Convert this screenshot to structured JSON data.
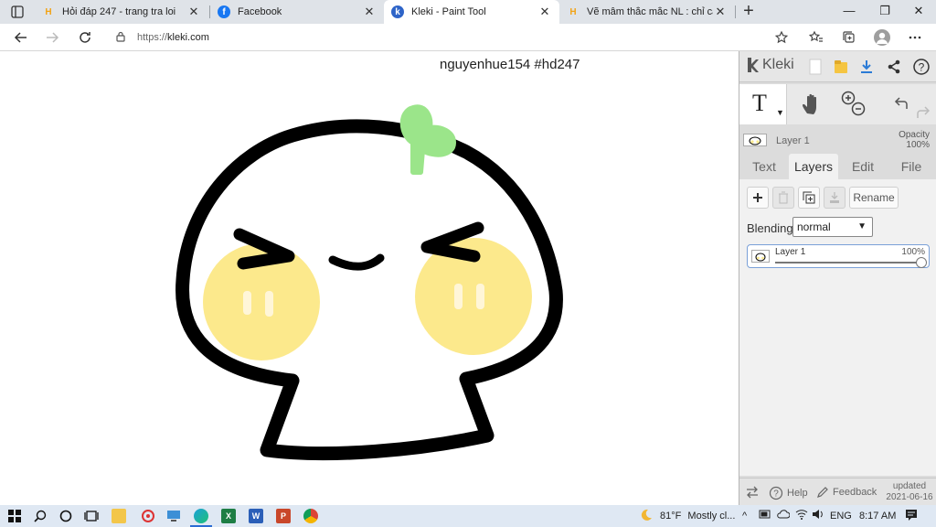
{
  "browser": {
    "tabs": [
      {
        "title": "Hỏi đáp 247 - trang tra loi",
        "favicon": "hoidap247-icon",
        "close": "✕",
        "active": false
      },
      {
        "title": "Facebook",
        "favicon": "facebook-icon",
        "close": "✕",
        "active": false
      },
      {
        "title": "Kleki - Paint Tool",
        "favicon": "kleki-icon",
        "close": "✕",
        "active": true
      },
      {
        "title": "Vẽ mâm thắc mắc NL : chỉ cách t",
        "favicon": "hoidap247-icon",
        "close": "✕",
        "active": false
      }
    ],
    "new_tab": "+",
    "url_scheme": "https://",
    "url_host": "kleki.com",
    "window_controls": {
      "minimize": "—",
      "restore": "❐",
      "close": "✕"
    }
  },
  "canvas": {
    "caption": "nguyenhue154 #hd247",
    "colors": {
      "outline": "#000000",
      "cheek": "#fce98c",
      "sprout": "#9be58a",
      "background": "#ffffff"
    }
  },
  "kleki": {
    "logo_text": "Kleki",
    "active_tool_glyph": "T",
    "current_layer": "Layer 1",
    "opacity_label": "Opacity",
    "opacity_value": "100%",
    "tabs": [
      {
        "label": "Text",
        "active": false
      },
      {
        "label": "Layers",
        "active": true
      },
      {
        "label": "Edit",
        "active": false
      },
      {
        "label": "File",
        "active": false
      }
    ],
    "rename_label": "Rename",
    "blending_label": "Blending",
    "blending_value": "normal",
    "layers": [
      {
        "name": "Layer 1",
        "opacity_label": "100%",
        "opacity": 1.0
      }
    ],
    "footer": {
      "help": "Help",
      "feedback": "Feedback",
      "updated_label": "updated",
      "updated_date": "2021-06-16"
    },
    "accent": "#2b7bd6"
  },
  "taskbar": {
    "apps": [
      "start-icon",
      "search-icon",
      "cortana-icon",
      "task-view-icon",
      "file-explorer-icon",
      "app-red-icon",
      "monitor-icon",
      "edge-icon",
      "excel-icon",
      "word-icon",
      "powerpoint-icon",
      "chrome-icon"
    ],
    "weather_temp": "81°F",
    "weather_text": "Mostly cl...",
    "language": "ENG",
    "time": "8:17 AM"
  }
}
